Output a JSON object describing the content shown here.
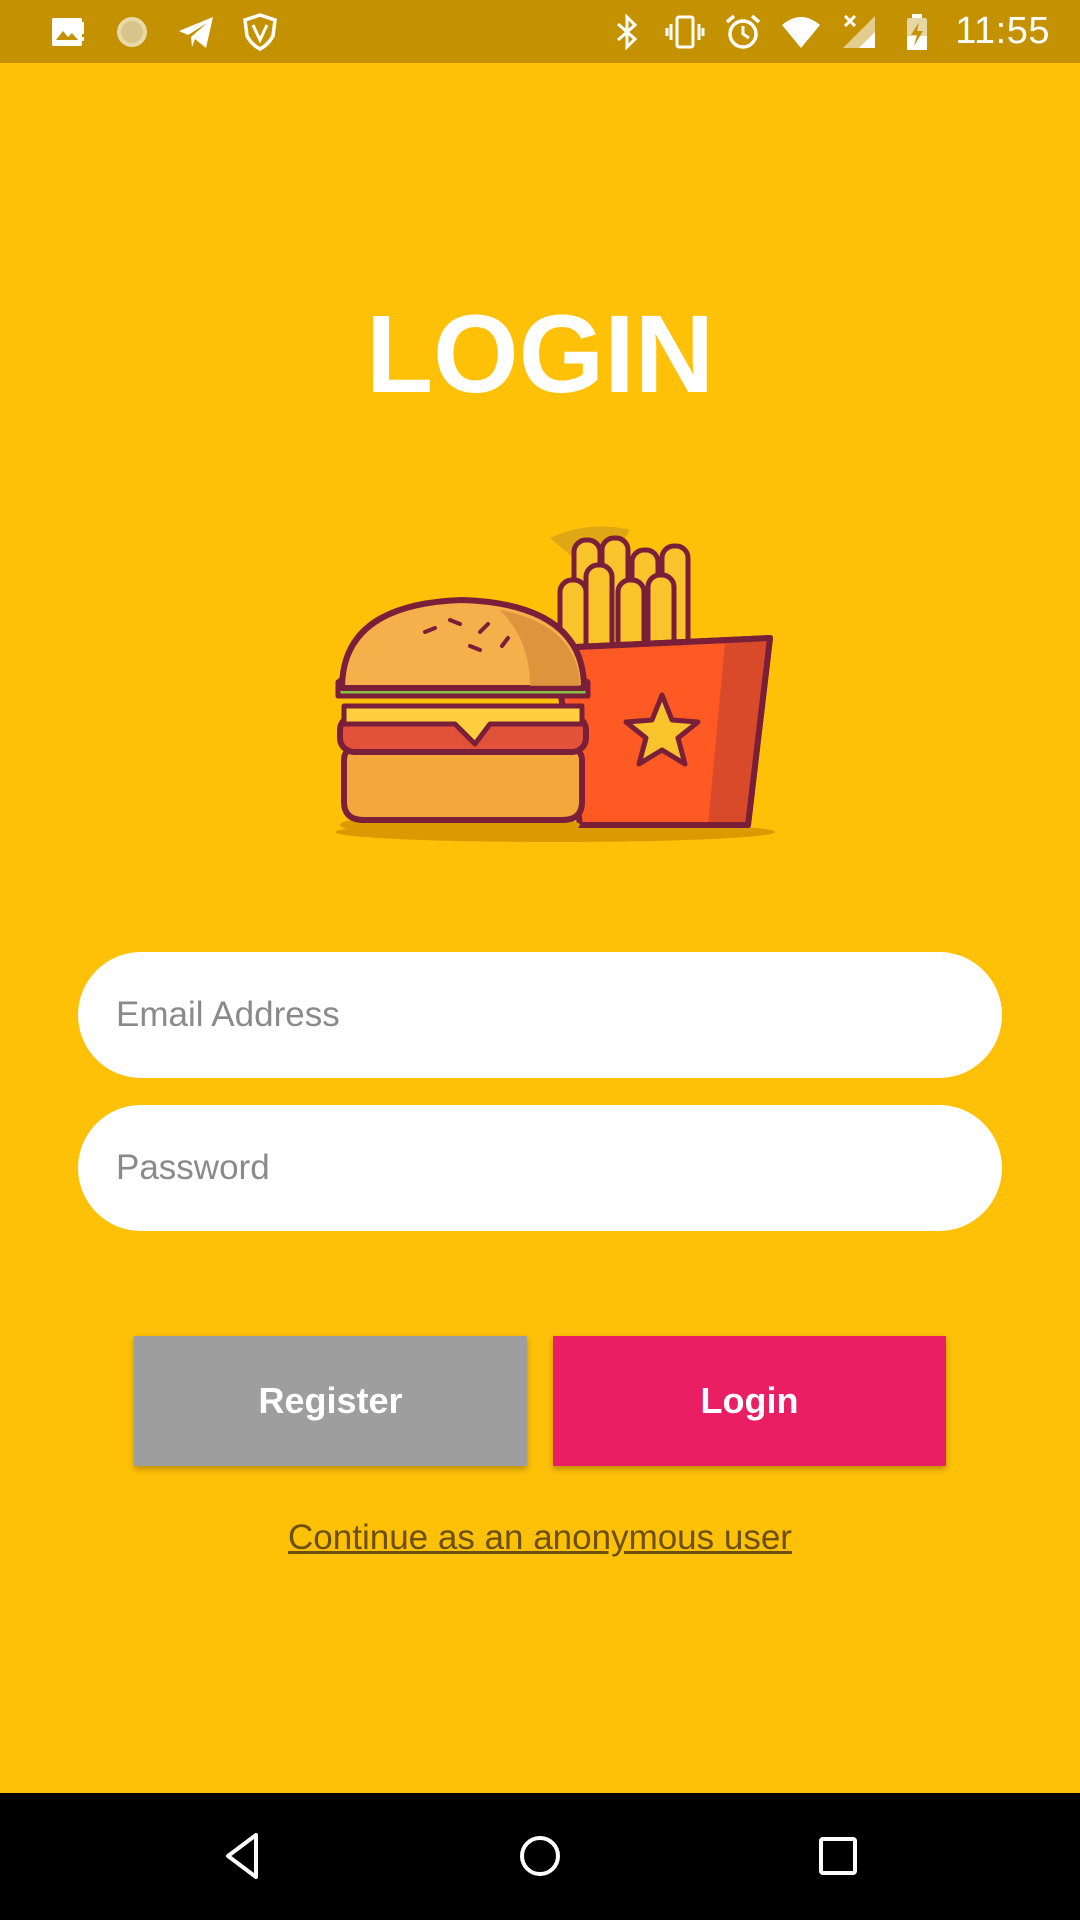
{
  "status_bar": {
    "time": "11:55",
    "left_icons": [
      "image-notification-icon",
      "sun-notification-icon",
      "telegram-icon",
      "shield-icon"
    ],
    "right_icons": [
      "bluetooth-icon",
      "vibrate-icon",
      "alarm-icon",
      "wifi-icon",
      "cellular-no-signal-icon",
      "battery-charging-icon"
    ]
  },
  "page": {
    "title": "LOGIN",
    "background_color": "#FFC107"
  },
  "form": {
    "email_placeholder": "Email Address",
    "password_placeholder": "Password",
    "email_value": "",
    "password_value": ""
  },
  "buttons": {
    "register_label": "Register",
    "login_label": "Login",
    "register_color": "#9E9E9E",
    "login_color": "#E91E63"
  },
  "links": {
    "anonymous_label": "Continue as an anonymous user"
  },
  "illustration": {
    "name": "burger-and-fries-illustration"
  },
  "nav_bar": {
    "icons": [
      "back-icon",
      "home-icon",
      "recents-icon"
    ]
  }
}
